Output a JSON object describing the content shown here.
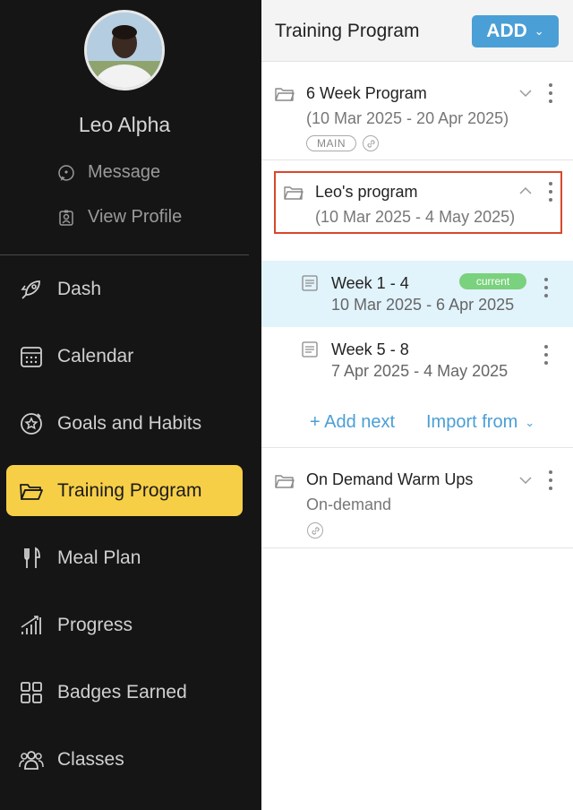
{
  "user": {
    "name": "Leo Alpha"
  },
  "profile_links": [
    {
      "label": "Message",
      "icon": "message-icon"
    },
    {
      "label": "View Profile",
      "icon": "profile-icon"
    }
  ],
  "nav": [
    {
      "label": "Dash",
      "icon": "rocket-icon",
      "active": false
    },
    {
      "label": "Calendar",
      "icon": "calendar-icon",
      "active": false
    },
    {
      "label": "Goals and Habits",
      "icon": "goals-icon",
      "active": false
    },
    {
      "label": "Training Program",
      "icon": "folder-icon",
      "active": true
    },
    {
      "label": "Meal Plan",
      "icon": "cutlery-icon",
      "active": false
    },
    {
      "label": "Progress",
      "icon": "progress-icon",
      "active": false
    },
    {
      "label": "Badges Earned",
      "icon": "badges-icon",
      "active": false
    },
    {
      "label": "Classes",
      "icon": "classes-icon",
      "active": false
    }
  ],
  "header": {
    "title": "Training Program",
    "add_label": "ADD"
  },
  "programs": [
    {
      "name": "6 Week Program",
      "dates": "(10 Mar 2025 - 20 Apr 2025)",
      "badge": "MAIN",
      "expanded": false
    },
    {
      "name": "Leo's program",
      "dates": "(10 Mar 2025 - 4 May 2025)",
      "expanded": true,
      "weeks": [
        {
          "name": "Week 1 - 4",
          "dates": "10 Mar 2025 - 6 Apr 2025",
          "badge": "current"
        },
        {
          "name": "Week 5 - 8",
          "dates": "7 Apr 2025 - 4 May 2025"
        }
      ]
    },
    {
      "name": "On Demand Warm Ups",
      "dates": "On-demand",
      "expanded": false
    }
  ],
  "actions": {
    "add_next": "+ Add next",
    "import_from": "Import from"
  },
  "colors": {
    "sidebar_bg": "#151515",
    "active_nav": "#f7cf47",
    "accent": "#4a9fd6",
    "current_badge": "#7ad17e",
    "highlight": "#d9472b"
  }
}
